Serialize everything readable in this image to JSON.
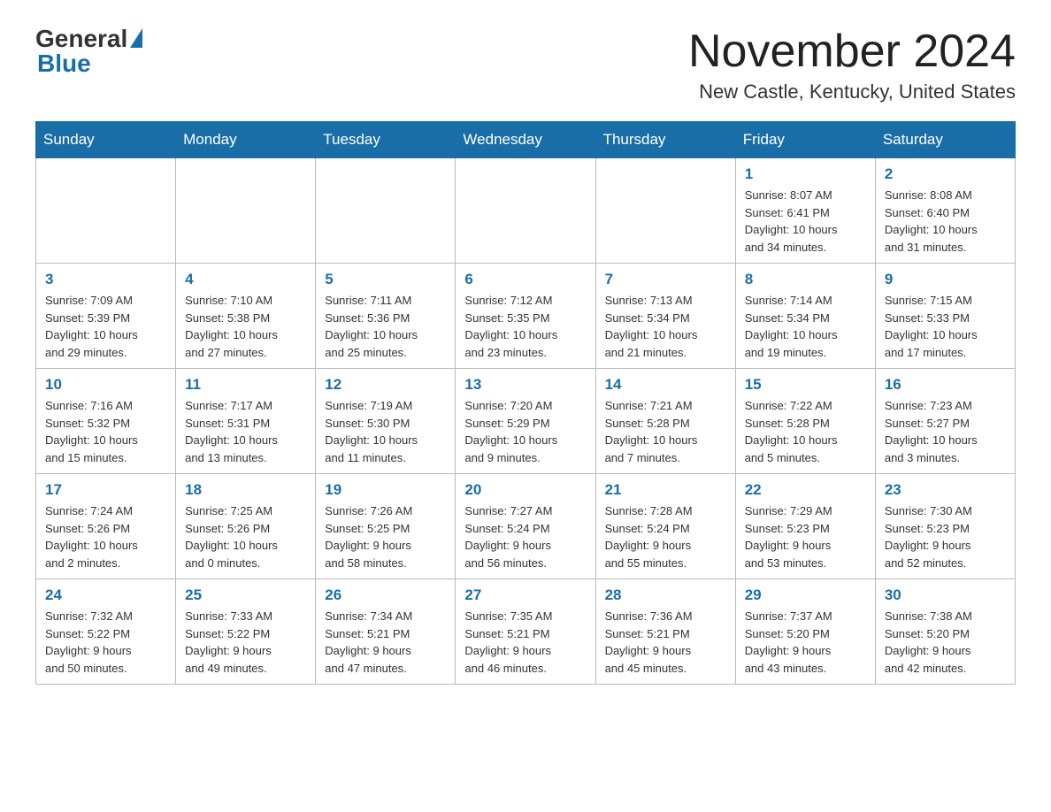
{
  "header": {
    "logo_general": "General",
    "logo_blue": "Blue",
    "title": "November 2024",
    "location": "New Castle, Kentucky, United States"
  },
  "calendar": {
    "days_of_week": [
      "Sunday",
      "Monday",
      "Tuesday",
      "Wednesday",
      "Thursday",
      "Friday",
      "Saturday"
    ],
    "weeks": [
      [
        {
          "day": "",
          "info": ""
        },
        {
          "day": "",
          "info": ""
        },
        {
          "day": "",
          "info": ""
        },
        {
          "day": "",
          "info": ""
        },
        {
          "day": "",
          "info": ""
        },
        {
          "day": "1",
          "info": "Sunrise: 8:07 AM\nSunset: 6:41 PM\nDaylight: 10 hours\nand 34 minutes."
        },
        {
          "day": "2",
          "info": "Sunrise: 8:08 AM\nSunset: 6:40 PM\nDaylight: 10 hours\nand 31 minutes."
        }
      ],
      [
        {
          "day": "3",
          "info": "Sunrise: 7:09 AM\nSunset: 5:39 PM\nDaylight: 10 hours\nand 29 minutes."
        },
        {
          "day": "4",
          "info": "Sunrise: 7:10 AM\nSunset: 5:38 PM\nDaylight: 10 hours\nand 27 minutes."
        },
        {
          "day": "5",
          "info": "Sunrise: 7:11 AM\nSunset: 5:36 PM\nDaylight: 10 hours\nand 25 minutes."
        },
        {
          "day": "6",
          "info": "Sunrise: 7:12 AM\nSunset: 5:35 PM\nDaylight: 10 hours\nand 23 minutes."
        },
        {
          "day": "7",
          "info": "Sunrise: 7:13 AM\nSunset: 5:34 PM\nDaylight: 10 hours\nand 21 minutes."
        },
        {
          "day": "8",
          "info": "Sunrise: 7:14 AM\nSunset: 5:34 PM\nDaylight: 10 hours\nand 19 minutes."
        },
        {
          "day": "9",
          "info": "Sunrise: 7:15 AM\nSunset: 5:33 PM\nDaylight: 10 hours\nand 17 minutes."
        }
      ],
      [
        {
          "day": "10",
          "info": "Sunrise: 7:16 AM\nSunset: 5:32 PM\nDaylight: 10 hours\nand 15 minutes."
        },
        {
          "day": "11",
          "info": "Sunrise: 7:17 AM\nSunset: 5:31 PM\nDaylight: 10 hours\nand 13 minutes."
        },
        {
          "day": "12",
          "info": "Sunrise: 7:19 AM\nSunset: 5:30 PM\nDaylight: 10 hours\nand 11 minutes."
        },
        {
          "day": "13",
          "info": "Sunrise: 7:20 AM\nSunset: 5:29 PM\nDaylight: 10 hours\nand 9 minutes."
        },
        {
          "day": "14",
          "info": "Sunrise: 7:21 AM\nSunset: 5:28 PM\nDaylight: 10 hours\nand 7 minutes."
        },
        {
          "day": "15",
          "info": "Sunrise: 7:22 AM\nSunset: 5:28 PM\nDaylight: 10 hours\nand 5 minutes."
        },
        {
          "day": "16",
          "info": "Sunrise: 7:23 AM\nSunset: 5:27 PM\nDaylight: 10 hours\nand 3 minutes."
        }
      ],
      [
        {
          "day": "17",
          "info": "Sunrise: 7:24 AM\nSunset: 5:26 PM\nDaylight: 10 hours\nand 2 minutes."
        },
        {
          "day": "18",
          "info": "Sunrise: 7:25 AM\nSunset: 5:26 PM\nDaylight: 10 hours\nand 0 minutes."
        },
        {
          "day": "19",
          "info": "Sunrise: 7:26 AM\nSunset: 5:25 PM\nDaylight: 9 hours\nand 58 minutes."
        },
        {
          "day": "20",
          "info": "Sunrise: 7:27 AM\nSunset: 5:24 PM\nDaylight: 9 hours\nand 56 minutes."
        },
        {
          "day": "21",
          "info": "Sunrise: 7:28 AM\nSunset: 5:24 PM\nDaylight: 9 hours\nand 55 minutes."
        },
        {
          "day": "22",
          "info": "Sunrise: 7:29 AM\nSunset: 5:23 PM\nDaylight: 9 hours\nand 53 minutes."
        },
        {
          "day": "23",
          "info": "Sunrise: 7:30 AM\nSunset: 5:23 PM\nDaylight: 9 hours\nand 52 minutes."
        }
      ],
      [
        {
          "day": "24",
          "info": "Sunrise: 7:32 AM\nSunset: 5:22 PM\nDaylight: 9 hours\nand 50 minutes."
        },
        {
          "day": "25",
          "info": "Sunrise: 7:33 AM\nSunset: 5:22 PM\nDaylight: 9 hours\nand 49 minutes."
        },
        {
          "day": "26",
          "info": "Sunrise: 7:34 AM\nSunset: 5:21 PM\nDaylight: 9 hours\nand 47 minutes."
        },
        {
          "day": "27",
          "info": "Sunrise: 7:35 AM\nSunset: 5:21 PM\nDaylight: 9 hours\nand 46 minutes."
        },
        {
          "day": "28",
          "info": "Sunrise: 7:36 AM\nSunset: 5:21 PM\nDaylight: 9 hours\nand 45 minutes."
        },
        {
          "day": "29",
          "info": "Sunrise: 7:37 AM\nSunset: 5:20 PM\nDaylight: 9 hours\nand 43 minutes."
        },
        {
          "day": "30",
          "info": "Sunrise: 7:38 AM\nSunset: 5:20 PM\nDaylight: 9 hours\nand 42 minutes."
        }
      ]
    ]
  }
}
